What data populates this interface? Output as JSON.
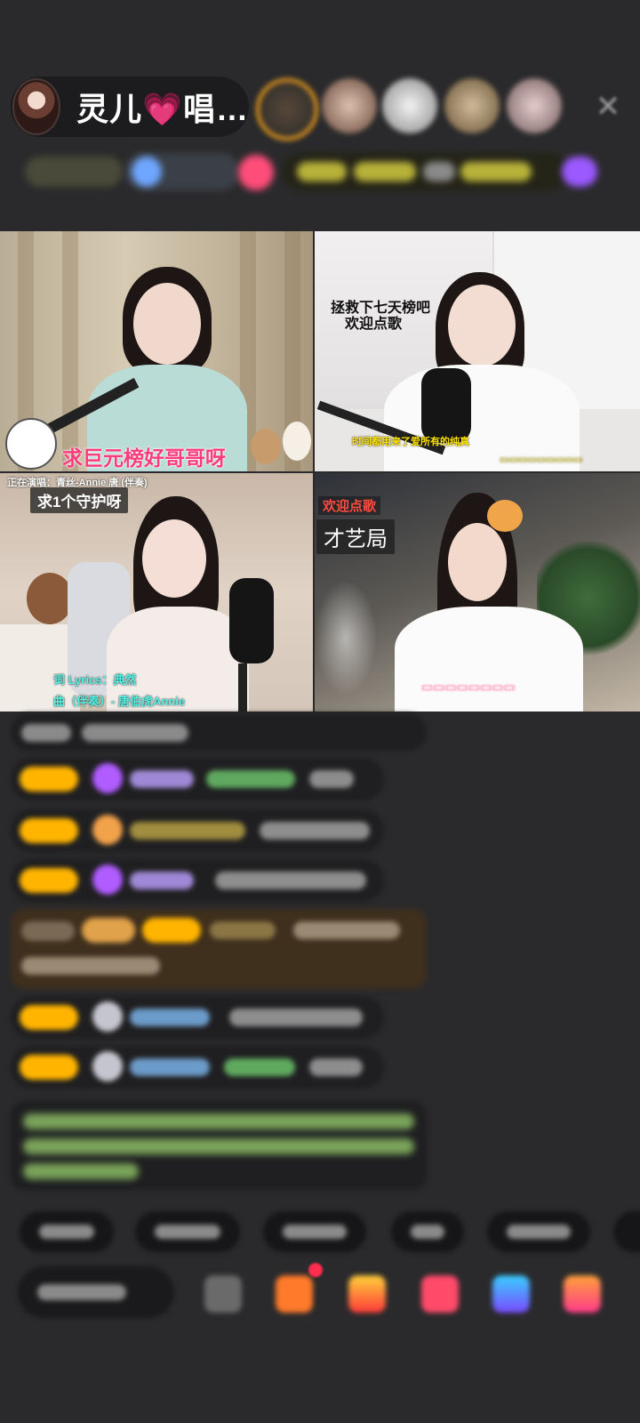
{
  "header": {
    "host_name": "灵儿",
    "host_heart": "💗",
    "host_suffix": "唱…",
    "close_icon": "close-icon"
  },
  "video_grid": {
    "cell1": {
      "caption": "求巨元榜好哥哥呀"
    },
    "cell2": {
      "caption_line1": "拯救下七天榜吧",
      "caption_line2": "欢迎点歌",
      "caption_bottom": "时间都用来了爱所有的纯真"
    },
    "cell3": {
      "top_info": "正在演唱：青丝-Annie 唐 (伴奏)",
      "tag": "求1个守护呀",
      "lyric_credit": "词 Lyrics：典然",
      "music_credit": "曲（伴奏）- 唐伯虎Annie"
    },
    "cell4": {
      "tag_small": "欢迎点歌",
      "tag_large": "才艺局"
    }
  },
  "colors": {
    "accent_pink": "#ff3b7c",
    "badge_gold": "#ffb400",
    "background": "#2a2a2c"
  }
}
